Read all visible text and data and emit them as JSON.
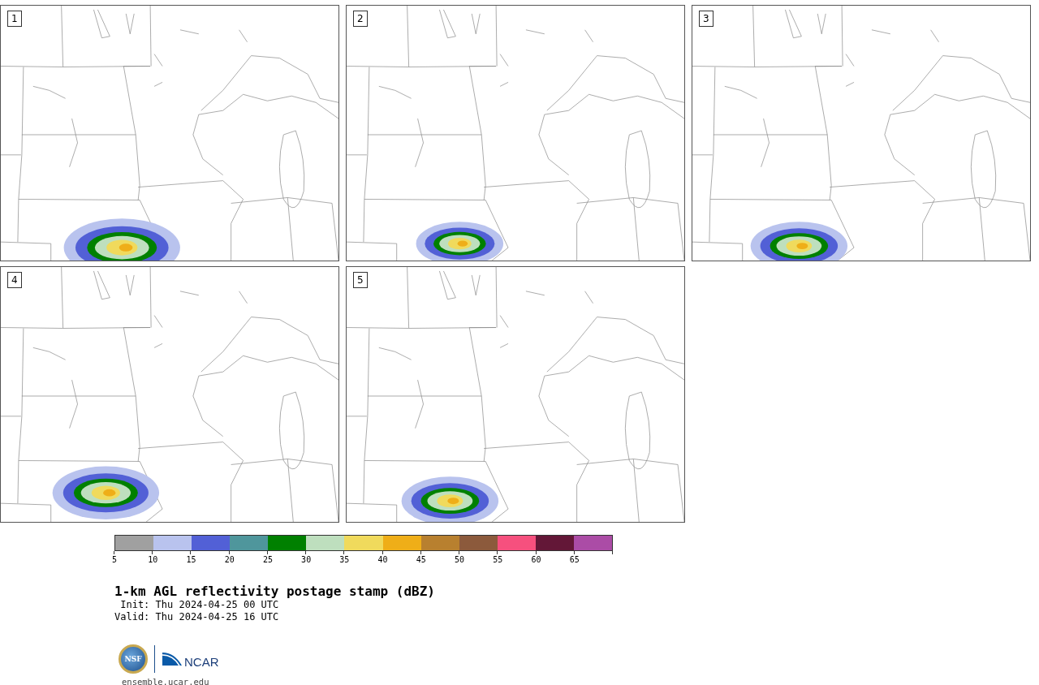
{
  "panels": [
    {
      "label": "1"
    },
    {
      "label": "2"
    },
    {
      "label": "3"
    },
    {
      "label": "4"
    },
    {
      "label": "5"
    }
  ],
  "colorbar": {
    "segments": [
      {
        "color": "#a0a0a0"
      },
      {
        "color": "#b9c3ee"
      },
      {
        "color": "#5260d6"
      },
      {
        "color": "#4f969c"
      },
      {
        "color": "#008000"
      },
      {
        "color": "#bedfbe"
      },
      {
        "color": "#f0da5c"
      },
      {
        "color": "#efae18"
      },
      {
        "color": "#b8802f"
      },
      {
        "color": "#8c5a3c"
      },
      {
        "color": "#f6507e"
      },
      {
        "color": "#631737"
      },
      {
        "color": "#ab4ca6"
      }
    ],
    "ticks": [
      "5",
      "10",
      "15",
      "20",
      "25",
      "30",
      "35",
      "40",
      "45",
      "50",
      "55",
      "60",
      "65"
    ]
  },
  "title": "1-km AGL reflectivity postage stamp (dBZ)",
  "init": " Init: Thu 2024-04-25 00 UTC",
  "valid": "Valid: Thu 2024-04-25 16 UTC",
  "logo": {
    "left": "NSF",
    "right": "NCAR"
  },
  "url": "ensemble.ucar.edu"
}
